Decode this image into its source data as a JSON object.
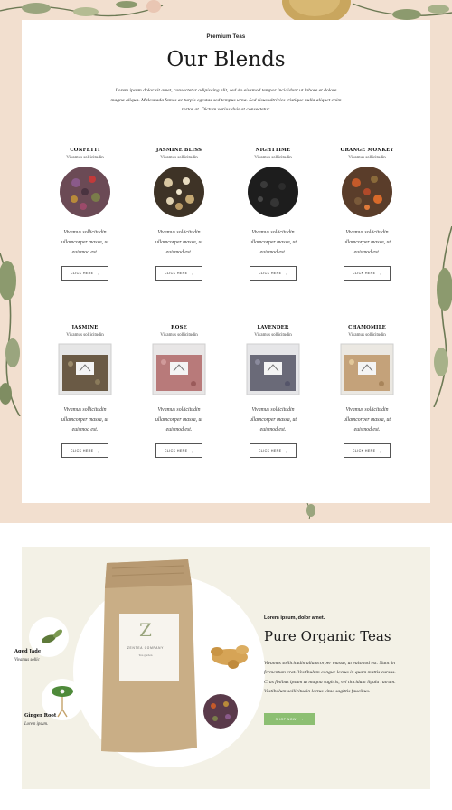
{
  "header": {
    "eyebrow": "Premium Teas",
    "title": "Our Blends",
    "intro": "Lorem ipsum dolor sit amet, consectetur adipiscing elit, sed do eiusmod tempor incididunt ut labore et dolore magna aliqua. Malesuada fames ac turpis egestas sed tempus urna. Sed risus ultricies tristique nulla aliquet enim tortor at. Dictum varius duis at consectetur."
  },
  "products": [
    {
      "name": "CONFETTI",
      "subtitle": "Vivamus sollicitudin",
      "description": "Vivamus sollicitudin ullamcorper massa, ut euismod est.",
      "button": "CLICK HERE",
      "image": "loose-leaf-tea-confetti"
    },
    {
      "name": "JASMINE BLISS",
      "subtitle": "Vivamus sollicitudin",
      "description": "Vivamus sollicitudin ullamcorper massa, ut euismod est.",
      "button": "CLICK HERE",
      "image": "loose-leaf-tea-jasmine-bliss"
    },
    {
      "name": "NIGHTTIME",
      "subtitle": "Vivamus sollicitudin",
      "description": "Vivamus sollicitudin ullamcorper massa, ut euismod est.",
      "button": "CLICK HERE",
      "image": "loose-leaf-tea-nighttime"
    },
    {
      "name": "ORANGE MONKEY",
      "subtitle": "Vivamus sollicitudin",
      "description": "Vivamus sollicitudin ullamcorper massa, ut euismod est.",
      "button": "CLICK HERE",
      "image": "loose-leaf-tea-orange-monkey"
    },
    {
      "name": "JASMINE",
      "subtitle": "Vivamus sollicitudin",
      "description": "Vivamus sollicitudin ullamcorper massa, ut euismod est.",
      "button": "CLICK HERE",
      "image": "tea-bag-jasmine"
    },
    {
      "name": "ROSE",
      "subtitle": "Vivamus sollicitudin",
      "description": "Vivamus sollicitudin ullamcorper massa, ut euismod est.",
      "button": "CLICK HERE",
      "image": "tea-bag-rose"
    },
    {
      "name": "LAVENDER",
      "subtitle": "Vivamus sollicitudin",
      "description": "Vivamus sollicitudin ullamcorper massa, ut euismod est.",
      "button": "CLICK HERE",
      "image": "tea-bag-lavender"
    },
    {
      "name": "CHAMOMILE",
      "subtitle": "Vivamus sollicitudin",
      "description": "Vivamus sollicitudin ullamcorper massa, ut euismod est.",
      "button": "CLICK HERE",
      "image": "tea-bag-chamomile"
    }
  ],
  "feature": {
    "eyebrow": "Lorem ipsum, dolor amet.",
    "title": "Pure Organic Teas",
    "body": "Vivamus sollicitudin ullamcorper massa, ut euismod est. Nunc in fermentum erat. Vestibulum congue lectus in quam mattis cursus. Cras finibus ipsum ut magna sagittis, vel tincidunt ligula rutrum. Vestibulum sollicitudin lectus vitae sagittis faucibus.",
    "button": "SHOP NOW",
    "bag_logo_letter": "Z",
    "bag_brand": "ZENTEA COMPANY",
    "bag_tagline": "Tea garden",
    "ingredients": [
      {
        "name": "Aged Jade",
        "subtitle": "Vivamus sollic"
      },
      {
        "name": "Ginger Root",
        "subtitle": "Lorem ipsum."
      }
    ]
  },
  "colors": {
    "peach_background": "#f2dfcf",
    "cream_panel": "#f3f1e6",
    "shop_button": "#8cbf72",
    "leaf_green": "#8a9a6a"
  }
}
